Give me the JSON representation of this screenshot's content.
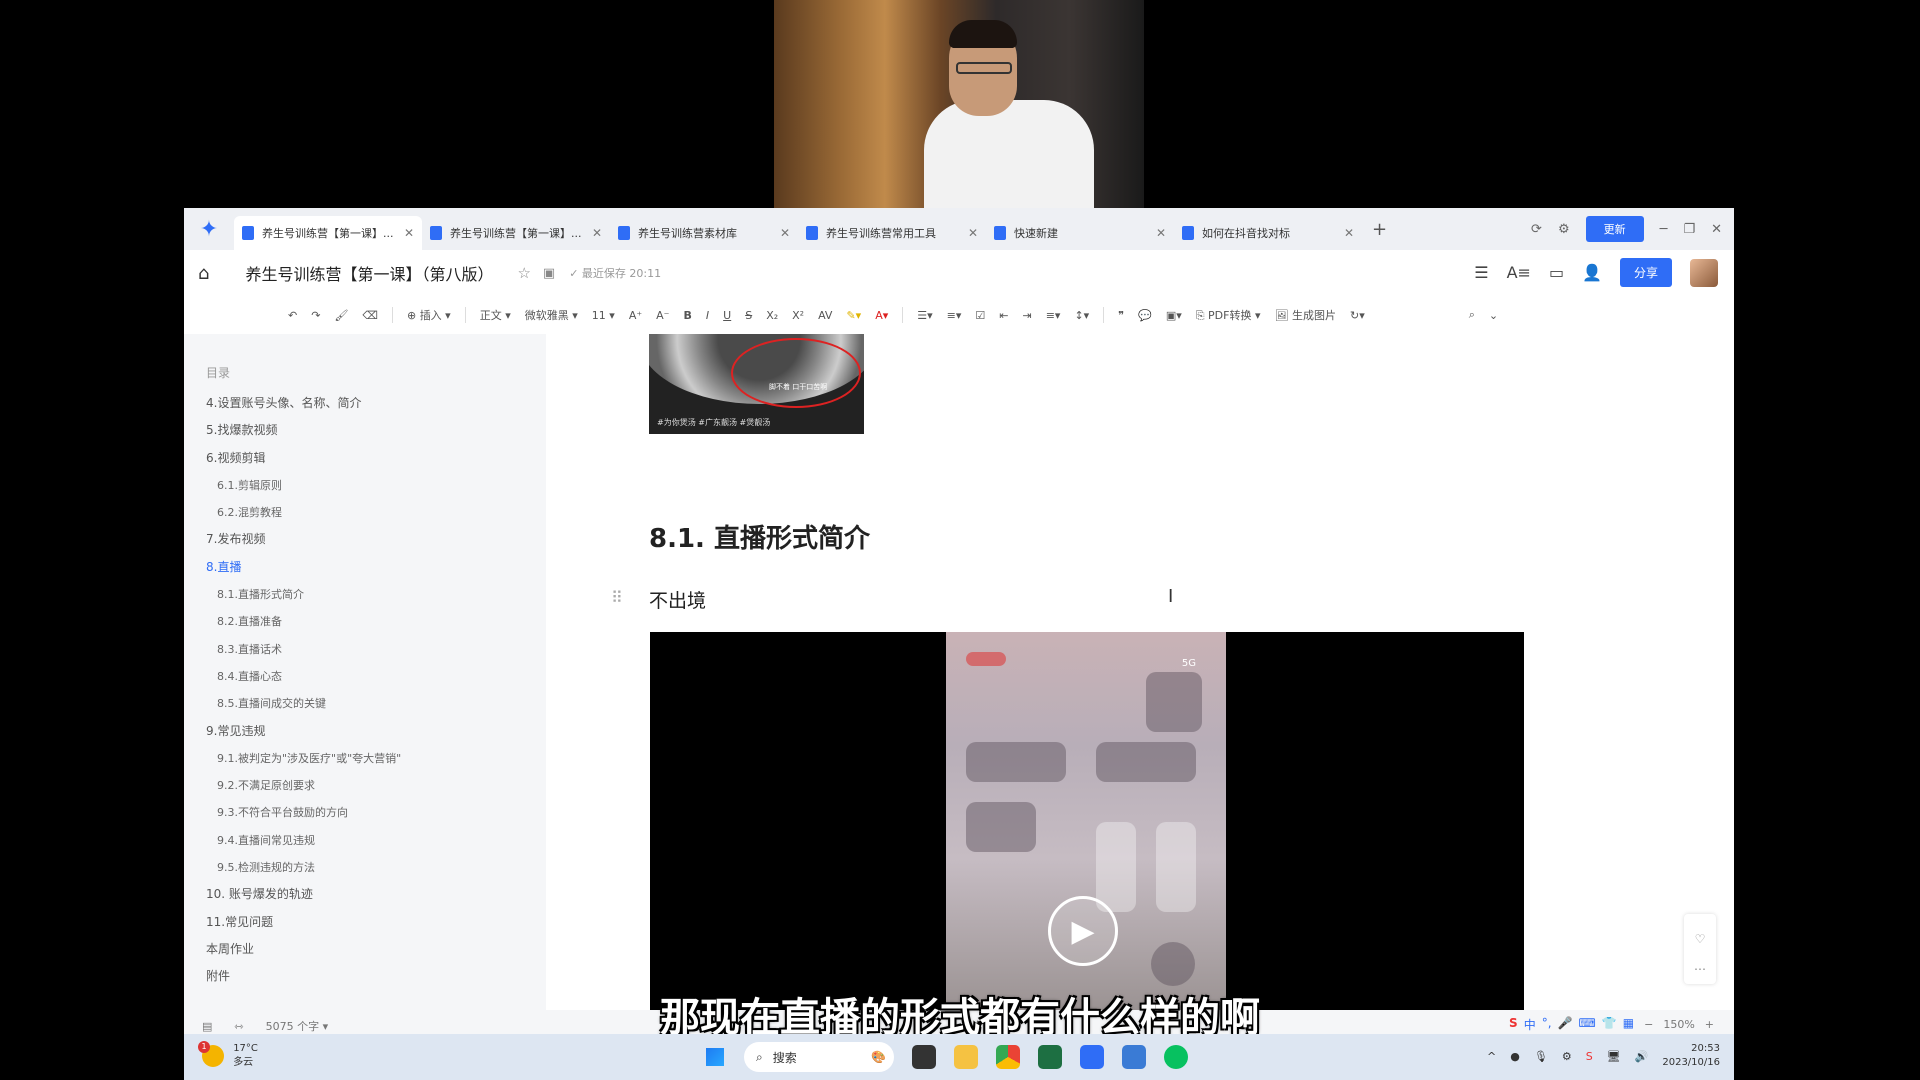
{
  "window": {
    "tabs": [
      {
        "label": "养生号训练营【第一课】...",
        "active": true
      },
      {
        "label": "养生号训练营【第一课】...",
        "active": false
      },
      {
        "label": "养生号训练营素材库",
        "active": false
      },
      {
        "label": "养生号训练营常用工具",
        "active": false
      },
      {
        "label": "快速新建",
        "active": false
      },
      {
        "label": "如何在抖音找对标",
        "active": false
      }
    ],
    "update_label": "更新"
  },
  "header": {
    "doc_title": "养生号训练营【第一课】（第八版）",
    "save_status": "最近保存 20:11",
    "share_label": "分享"
  },
  "toolbar": {
    "insert_label": "插入",
    "style_label": "正文",
    "font_label": "微软雅黑",
    "size_label": "11",
    "pdf_label": "PDF转换",
    "image_label": "生成图片"
  },
  "sidebar": {
    "title": "目录",
    "items": [
      {
        "label": "4.设置账号头像、名称、简介",
        "level": 1
      },
      {
        "label": "5.找爆款视频",
        "level": 1
      },
      {
        "label": "6.视频剪辑",
        "level": 1
      },
      {
        "label": "6.1.剪辑原则",
        "level": 2
      },
      {
        "label": "6.2.混剪教程",
        "level": 2
      },
      {
        "label": "7.发布视频",
        "level": 1
      },
      {
        "label": "8.直播",
        "level": 1,
        "active": true
      },
      {
        "label": "8.1.直播形式简介",
        "level": 2
      },
      {
        "label": "8.2.直播准备",
        "level": 2
      },
      {
        "label": "8.3.直播话术",
        "level": 2
      },
      {
        "label": "8.4.直播心态",
        "level": 2
      },
      {
        "label": "8.5.直播间成交的关键",
        "level": 2
      },
      {
        "label": "9.常见违规",
        "level": 1
      },
      {
        "label": "9.1.被判定为\"涉及医疗\"或\"夸大营销\"",
        "level": 2
      },
      {
        "label": "9.2.不满足原创要求",
        "level": 2
      },
      {
        "label": "9.3.不符合平台鼓励的方向",
        "level": 2
      },
      {
        "label": "9.4.直播间常见违规",
        "level": 2
      },
      {
        "label": "9.5.检测违规的方法",
        "level": 2
      },
      {
        "label": "10. 账号爆发的轨迹",
        "level": 1
      },
      {
        "label": "11.常见问题",
        "level": 1
      },
      {
        "label": "本周作业",
        "level": 1
      },
      {
        "label": "附件",
        "level": 1
      }
    ]
  },
  "document": {
    "thumb_caption": "#为你煲汤 #广东靓汤 #煲靓汤",
    "thumb_tag": "脚不着 口干口苦啊",
    "heading": "8.1.  直播形式简介",
    "paragraph": "不出境",
    "phone_signal": "5G"
  },
  "statusbar": {
    "word_count": "5075 个字",
    "zoom": "150%"
  },
  "subtitle": "那现在直播的形式都有什么样的啊",
  "taskbar": {
    "weather_temp": "17°C",
    "weather_desc": "多云",
    "weather_badge": "1",
    "search_label": "搜索",
    "time": "20:53",
    "date": "2023/10/16"
  },
  "colors": {
    "accent": "#2f6df6",
    "subtitle_text": "#ffffff"
  }
}
